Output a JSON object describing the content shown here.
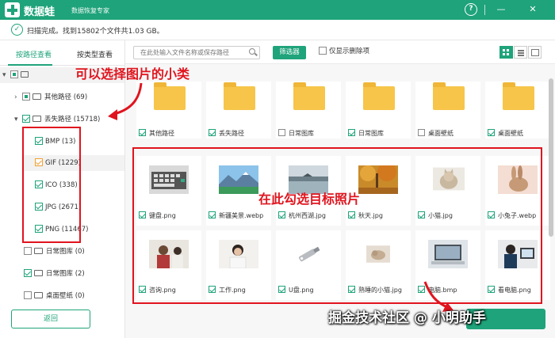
{
  "app": {
    "name": "数据蛙",
    "subtitle": "数据恢复专家"
  },
  "titlebar": {
    "help_label": "?",
    "minimize_label": "—",
    "close_label": "✕"
  },
  "status": {
    "text": "扫描完成。找到15802个文件共1.03 GB。"
  },
  "tabs": [
    {
      "label": "按路径查看",
      "active": true
    },
    {
      "label": "按类型查看",
      "active": false
    }
  ],
  "tree": [
    {
      "label": "其他路径 (69)"
    },
    {
      "label": "丢失路径 (15718)"
    },
    {
      "label": "BMP (13)"
    },
    {
      "label": "GIF (1229)"
    },
    {
      "label": "ICO (338)"
    },
    {
      "label": "JPG (2671)"
    },
    {
      "label": "PNG (11467)"
    },
    {
      "label": "日常图库 (0)"
    },
    {
      "label": "日常图库 (2)"
    },
    {
      "label": "桌面壁纸 (0)"
    }
  ],
  "back_button": "返回",
  "toolbar": {
    "search_placeholder": "在此处输入文件名称或保存路径",
    "filter_label": "筛选器",
    "only_deleted_label": "仅显示删除项"
  },
  "folders": [
    {
      "label": "其他路径"
    },
    {
      "label": "丢失路径"
    },
    {
      "label": "日常图库"
    },
    {
      "label": "日常图库"
    },
    {
      "label": "桌面壁纸"
    },
    {
      "label": "桌面壁纸"
    }
  ],
  "images": [
    {
      "label": "键盘.png"
    },
    {
      "label": "新疆美景.webp"
    },
    {
      "label": "杭州西湖.jpg"
    },
    {
      "label": "秋天.jpg"
    },
    {
      "label": "小猫.jpg"
    },
    {
      "label": "小兔子.webp"
    },
    {
      "label": "咨询.png"
    },
    {
      "label": "工作.png"
    },
    {
      "label": "U盘.png"
    },
    {
      "label": "熟睡的小猫.jpg"
    },
    {
      "label": "电脑.bmp"
    },
    {
      "label": "看电脑.png"
    }
  ],
  "annotations": {
    "left_note": "可以选择图片的小类",
    "right_note": "在此勾选目标照片",
    "color": "#e0141e"
  },
  "watermark": "掘金技术社区 @ 小明助手",
  "colors": {
    "accent": "#1fa37a",
    "folder": "#f6c54a"
  }
}
